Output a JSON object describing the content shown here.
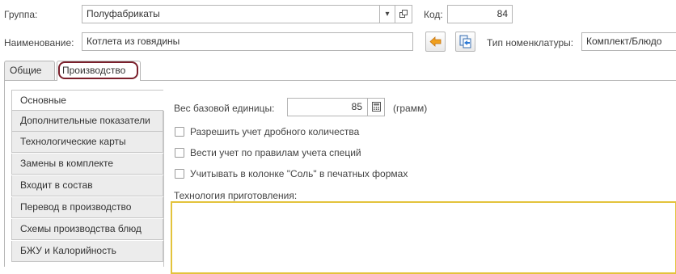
{
  "header": {
    "group_label": "Группа:",
    "group_value": "Полуфабрикаты",
    "code_label": "Код:",
    "code_value": "84",
    "name_label": "Наименование:",
    "name_value": "Котлета из говядины",
    "type_label": "Тип номенклатуры:",
    "type_value": "Комплект/Блюдо"
  },
  "tabs": [
    {
      "label": "Общие"
    },
    {
      "label": "Производство"
    }
  ],
  "sidebar": {
    "items": [
      {
        "label": "Основные"
      },
      {
        "label": "Дополнительные показатели"
      },
      {
        "label": "Технологические карты"
      },
      {
        "label": "Замены в комплекте"
      },
      {
        "label": "Входит в состав"
      },
      {
        "label": "Перевод в производство"
      },
      {
        "label": "Схемы производства блюд"
      },
      {
        "label": "БЖУ и Калорийность"
      }
    ]
  },
  "main": {
    "weight_label": "Вес базовой единицы:",
    "weight_value": "85",
    "weight_unit": "(грамм)",
    "checkboxes": [
      {
        "label": "Разрешить учет дробного количества"
      },
      {
        "label": "Вести учет по правилам учета специй"
      },
      {
        "label": "Учитывать в колонке \"Соль\" в печатных формах"
      }
    ],
    "tech_label": "Технология приготовления:",
    "tech_value": ""
  },
  "colors": {
    "accent_highlight": "#7a1f2b",
    "text_area_border": "#e3c33c",
    "arrow_orange": "#f0a01e"
  }
}
